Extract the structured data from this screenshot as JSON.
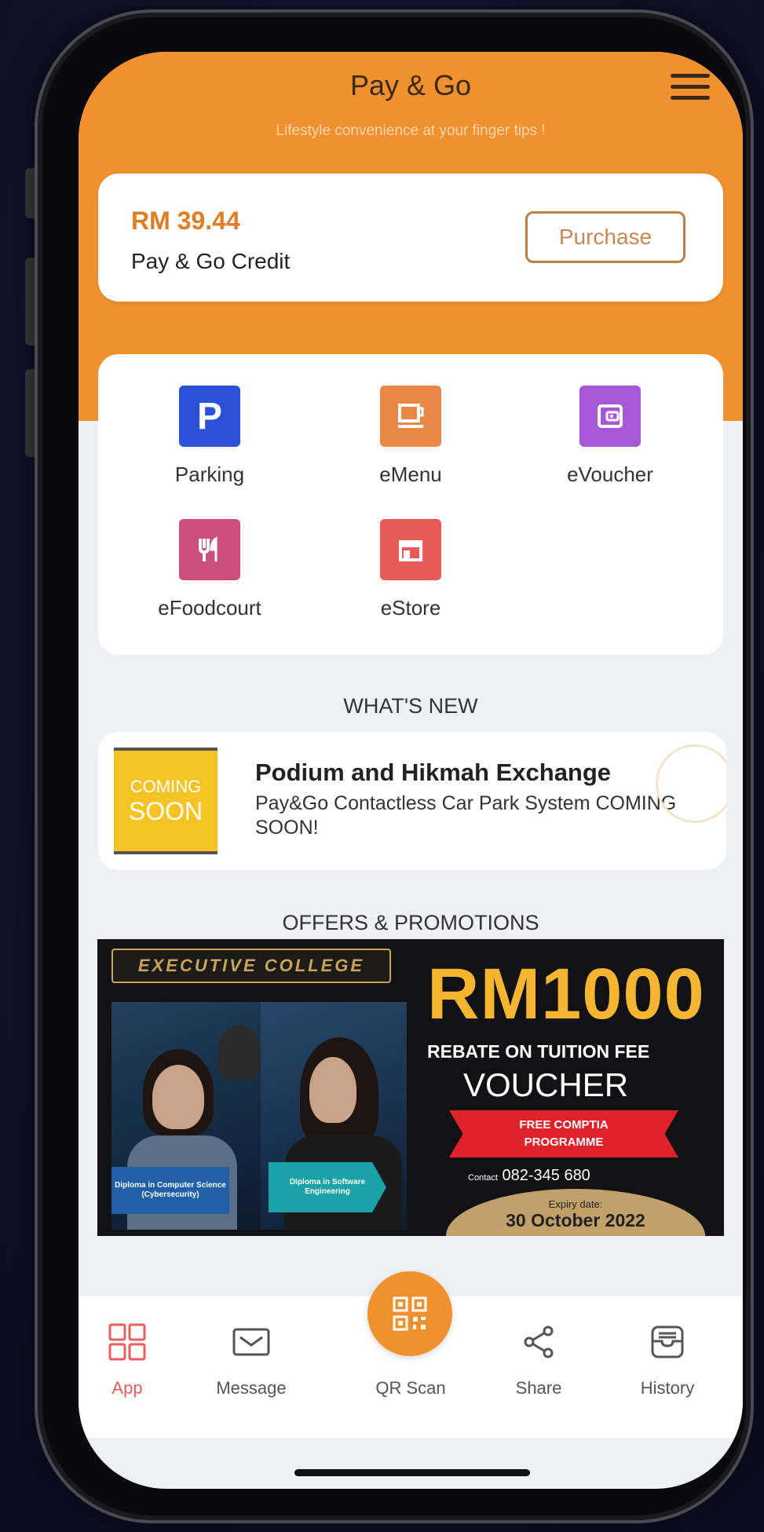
{
  "app": {
    "title": "Pay & Go",
    "tagline": "Lifestyle convenience at your finger tips !"
  },
  "credit": {
    "amount": "RM 39.44",
    "label": "Pay & Go Credit",
    "purchase_label": "Purchase"
  },
  "services": [
    {
      "label": "Parking",
      "icon": "parking-icon",
      "color": "#2b52d6"
    },
    {
      "label": "eMenu",
      "icon": "cup-icon",
      "color": "#e8894a"
    },
    {
      "label": "eVoucher",
      "icon": "wallet-icon",
      "color": "#a857d9"
    },
    {
      "label": "eFoodcourt",
      "icon": "fork-knife-icon",
      "color": "#cc4f7e"
    },
    {
      "label": "eStore",
      "icon": "store-icon",
      "color": "#e65a5a"
    }
  ],
  "whats_new": {
    "title": "WHAT'S NEW",
    "badge_line1": "COMING",
    "badge_line2": "SOON",
    "item_title": "Podium and Hikmah Exchange",
    "item_body": "Pay&Go Contactless Car Park System COMING SOON!"
  },
  "offers": {
    "title": "OFFERS & PROMOTIONS",
    "college": "EXECUTIVE COLLEGE",
    "diploma1": "Diploma in Computer Science (Cybersecurity)",
    "diploma2": "Diploma in Software Engineering",
    "amount": "RM1000",
    "rebate": "REBATE ON TUITION FEE",
    "voucher": "VOUCHER",
    "free1": "FREE COMPTIA",
    "free2": "PROGRAMME",
    "contact_label": "Contact",
    "contact_number": "082-345 680",
    "expiry_label": "Expiry date:",
    "expiry_date": "30 October 2022"
  },
  "tabs": [
    {
      "label": "App",
      "icon": "grid-icon",
      "active": true
    },
    {
      "label": "Message",
      "icon": "envelope-icon"
    },
    {
      "label": "QR Scan",
      "icon": "qr-code-icon"
    },
    {
      "label": "Share",
      "icon": "share-icon"
    },
    {
      "label": "History",
      "icon": "inbox-icon"
    }
  ],
  "colors": {
    "brand_orange": "#f0902f",
    "active_tab": "#e85d5d",
    "promo_gold": "#f5b531"
  }
}
